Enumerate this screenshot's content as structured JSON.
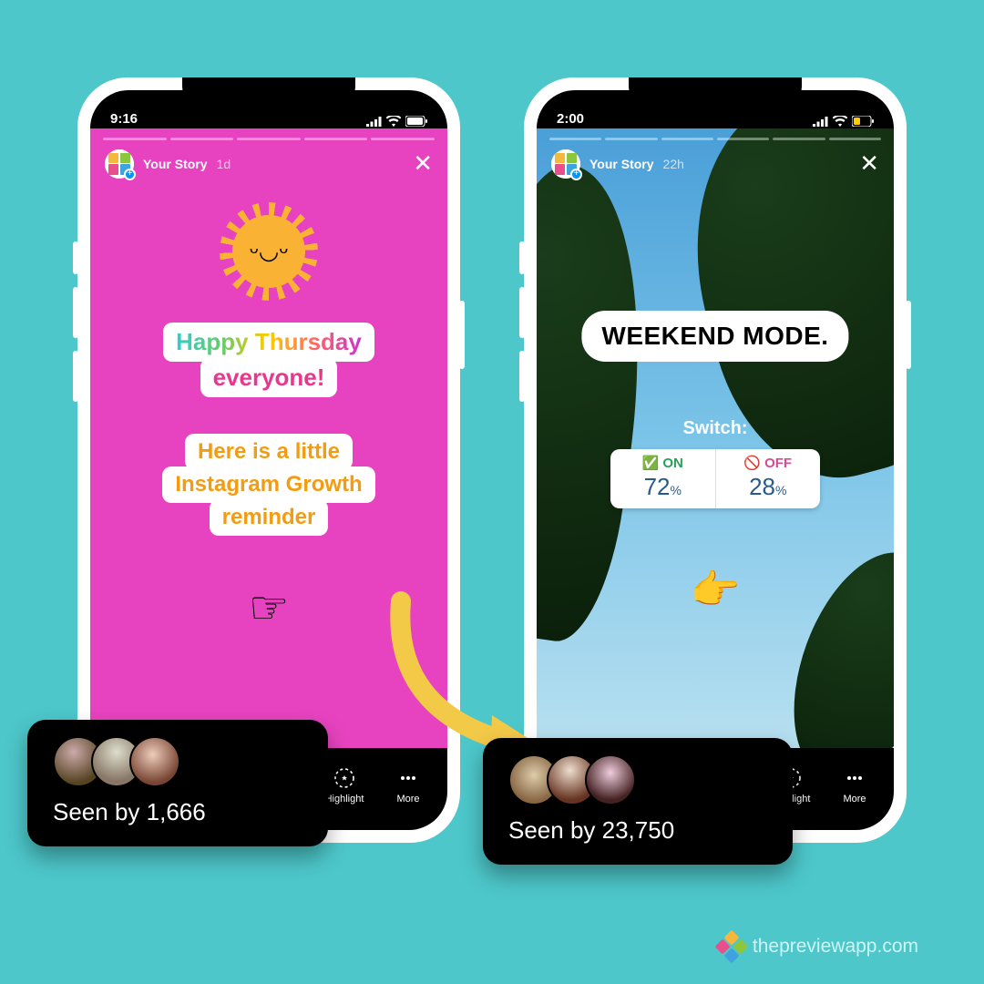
{
  "credit": "thepreviewapp.com",
  "left": {
    "time": "9:16",
    "story_label": "Your Story",
    "story_age": "1d",
    "headline1": "Happy Thursday",
    "headline2": "everyone!",
    "body1": "Here is a little",
    "body2": "Instagram Growth",
    "body3": "reminder",
    "seen_label": "Seen by 1,666",
    "footer": {
      "highlight": "Highlight",
      "more": "More"
    }
  },
  "right": {
    "time": "2:00",
    "story_label": "Your Story",
    "story_age": "22h",
    "weekend": "WEEKEND MODE.",
    "switch_label": "Switch:",
    "poll": {
      "on_label": "ON",
      "off_label": "OFF",
      "on_pct": "72",
      "off_pct": "28",
      "pct_sym": "%"
    },
    "seen_label": "Seen by 23,750",
    "footer": {
      "highlight": "Highlight",
      "more": "More"
    }
  }
}
